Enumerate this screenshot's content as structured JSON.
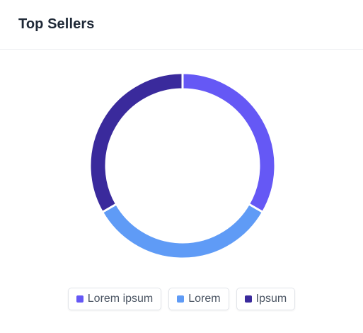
{
  "header": {
    "title": "Top Sellers"
  },
  "colors": {
    "series_1": "#6558f5",
    "series_2": "#5f9bf6",
    "series_3": "#3a2a9c"
  },
  "chart_data": {
    "type": "pie",
    "style": "donut",
    "categories": [
      "Lorem ipsum",
      "Lorem",
      "Ipsum"
    ],
    "values": [
      33.3,
      33.3,
      33.3
    ],
    "colors": [
      "#6558f5",
      "#5f9bf6",
      "#3a2a9c"
    ],
    "legend_position": "bottom-center",
    "title": ""
  }
}
